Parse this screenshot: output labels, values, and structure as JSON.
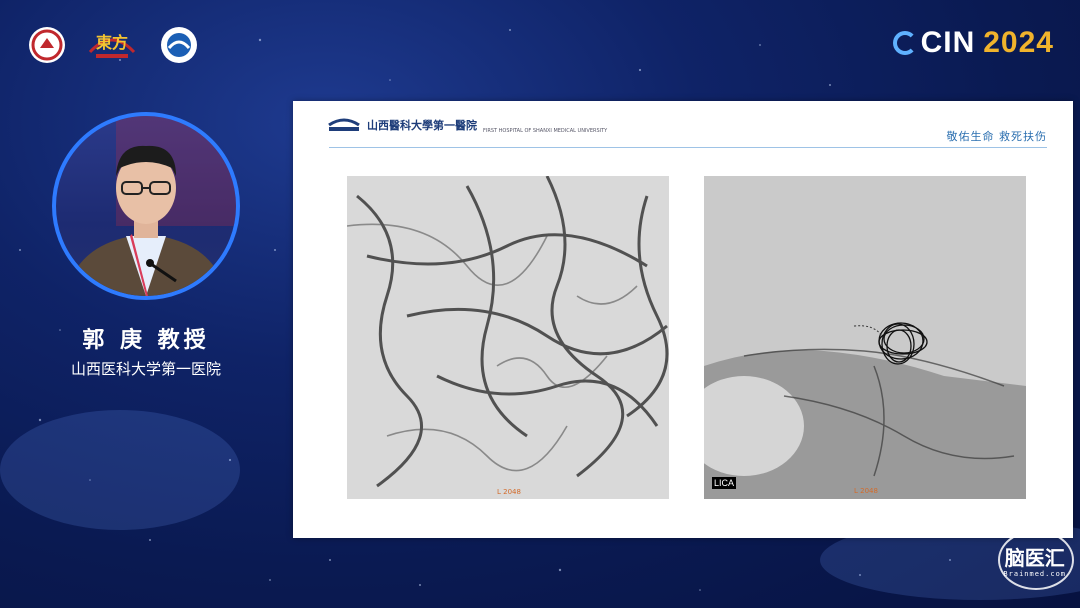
{
  "header": {
    "logos": [
      "university-seal-logo",
      "dongfang-logo",
      "wave-emblem-logo"
    ],
    "brand_prefix": "CIN",
    "brand_year": "2024",
    "brand_accent": "#f0b32c"
  },
  "speaker": {
    "name": "郭 庚 教授",
    "affiliation": "山西医科大学第一医院"
  },
  "slide": {
    "hospital_name": "山西醫科大學第一醫院",
    "hospital_name_en": "FIRST HOSPITAL OF SHANXI MEDICAL UNIVERSITY",
    "motto": "敬佑生命  救死扶伤",
    "left_image_caption": "L 2048",
    "right_image_caption": "L 2048",
    "right_image_label": "LICA"
  },
  "watermark": {
    "text": "脑医汇",
    "sub": "Brainmed.com"
  }
}
